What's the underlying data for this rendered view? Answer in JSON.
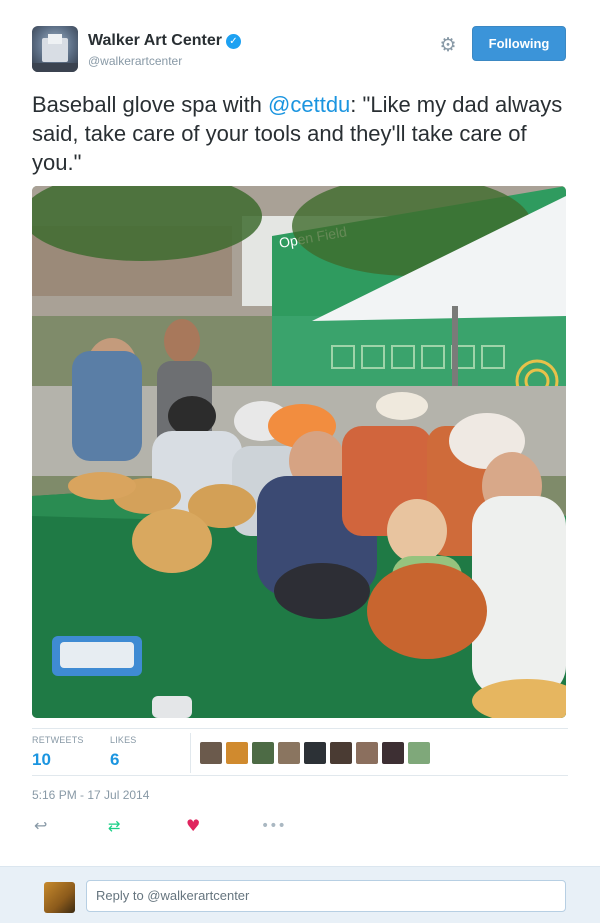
{
  "account": {
    "name": "Walker Art Center",
    "handle": "@walkerartcenter",
    "verified_icon": "verified-badge-icon",
    "follow_label": "Following"
  },
  "tweet": {
    "text_before": "Baseball glove spa with ",
    "mention": "@cettdu",
    "text_after": ": \"Like my dad always said, take care of your tools and they'll take care of you.\"",
    "image_signage": "Open Field"
  },
  "stats": {
    "retweets_label": "RETWEETS",
    "retweets_value": "10",
    "likes_label": "LIKES",
    "likes_value": "6"
  },
  "timestamp": "5:16 PM - 17 Jul 2014",
  "actions": {
    "reply_icon": "reply-icon",
    "retweet_icon": "retweet-icon",
    "like_icon": "heart-icon",
    "more_icon": "more-icon"
  },
  "reply": {
    "placeholder": "Reply to @walkerartcenter"
  },
  "colors": {
    "accent": "#1b95e0",
    "button": "#3b94d9",
    "like": "#e0245e",
    "retweet": "#19cf86",
    "muted": "#8899a6"
  }
}
